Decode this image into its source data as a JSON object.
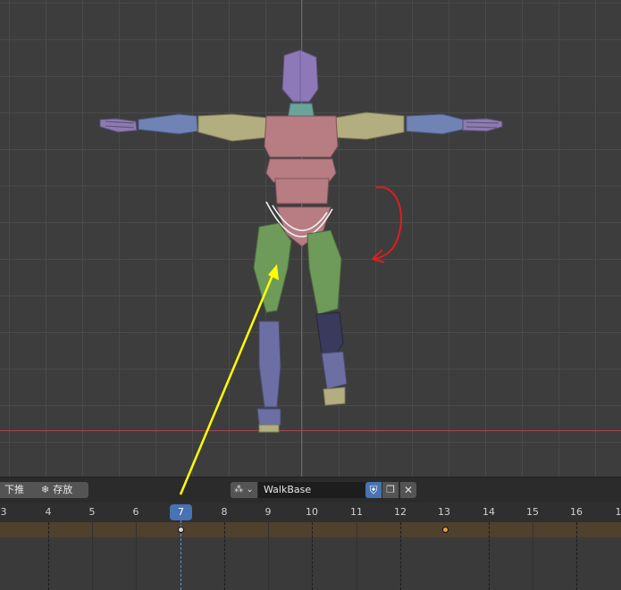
{
  "header": {
    "push_down_label": "下推",
    "stash_label": "存放",
    "stash_icon": "snowflake-icon",
    "action_selector_icon": "action-icon",
    "action_name": "WalkBase",
    "fake_user_icon": "shield-check-icon",
    "new_action_icon": "duplicate-icon",
    "unlink_icon": "close-icon"
  },
  "timeline": {
    "current_frame": "7",
    "frame_labels": [
      "3",
      "4",
      "5",
      "6",
      "8",
      "9",
      "10",
      "11",
      "12",
      "13",
      "14",
      "15",
      "16",
      "1"
    ],
    "keyframes": [
      "7",
      "13"
    ]
  },
  "colors": {
    "accent": "#4772b3",
    "summary_strip": "#50402e",
    "keyframe_fill": "#e8a23a",
    "annotation_arrow": "#ffff00",
    "annotation_curve": "#e11d1d"
  }
}
